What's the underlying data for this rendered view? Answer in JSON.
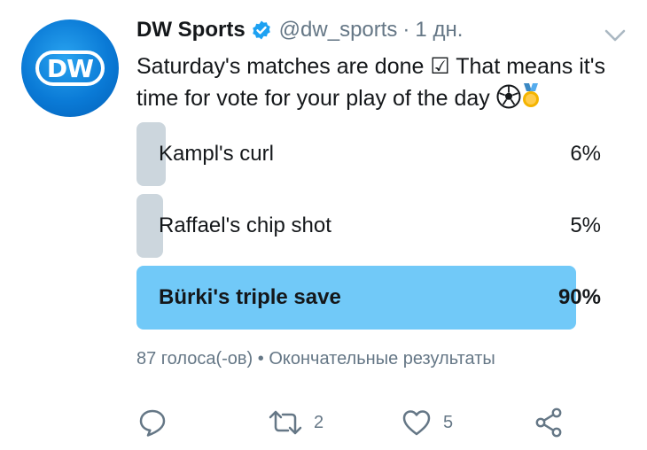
{
  "tweet": {
    "author_name": "DW Sports",
    "handle": "@dw_sports",
    "separator": "·",
    "time": "1 дн.",
    "text": "Saturday's matches are done ☑ That means it's time for vote for your play of the day",
    "avatar_text": "DW",
    "verified": true
  },
  "poll": {
    "options": [
      {
        "label": "Kampl's curl",
        "percent": "6%",
        "share": 6,
        "winner": false
      },
      {
        "label": "Raffael's chip shot",
        "percent": "5%",
        "share": 5,
        "winner": false
      },
      {
        "label": "Bürki's triple save",
        "percent": "90%",
        "share": 90,
        "winner": true
      }
    ],
    "votes": "87 голоса(-ов)",
    "meta_separator": "•",
    "status": "Окончательные результаты"
  },
  "actions": {
    "reply": {
      "icon": "reply-icon",
      "count": ""
    },
    "retweet": {
      "icon": "retweet-icon",
      "count": "2"
    },
    "like": {
      "icon": "heart-icon",
      "count": "5"
    },
    "share": {
      "icon": "share-icon",
      "count": ""
    }
  },
  "colors": {
    "brand_blue": "#0a7ad6",
    "verified_blue": "#1da1f2",
    "winner_bar": "#71c9f8",
    "loser_bar": "#ccd6dd",
    "muted_text": "#657786"
  }
}
